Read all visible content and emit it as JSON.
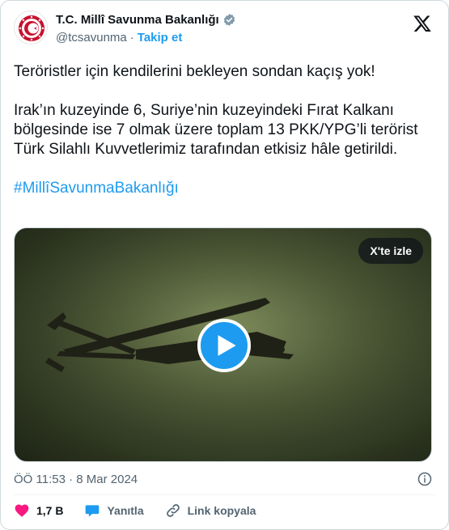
{
  "account": {
    "display_name": "T.C. Millî Savunma Bakanlığı",
    "handle": "@tcsavunma",
    "separator": "·",
    "follow_label": "Takip et"
  },
  "tweet": {
    "paragraph_1": "Teröristler için kendilerini bekleyen sondan kaçış yok!",
    "paragraph_2": "Irak’ın kuzeyinde 6, Suriye’nin kuzeyindeki Fırat Kalkanı bölgesinde ise 7 olmak üzere toplam 13 PKK/YPG’li terörist Türk Silahlı Kuvvetlerimiz tarafından etkisiz hâle getirildi.",
    "hashtag": "#MillîSavunmaBakanlığı"
  },
  "media": {
    "watch_label": "X'te izle"
  },
  "meta": {
    "timestamp": "ÖÖ 11:53 · 8 Mar 2024"
  },
  "actions": {
    "likes": "1,7 B",
    "reply": "Yanıtla",
    "copy_link": "Link kopyala"
  },
  "colors": {
    "accent": "#1d9bf0",
    "like": "#f91880",
    "muted": "#536471",
    "text": "#0f1419"
  },
  "icons": {
    "avatar": "ministry-emblem-icon",
    "verified": "verified-badge-icon",
    "brand": "x-logo-icon",
    "play": "play-icon",
    "info": "info-icon",
    "like": "heart-icon",
    "reply": "speech-bubble-icon",
    "link": "link-icon"
  }
}
